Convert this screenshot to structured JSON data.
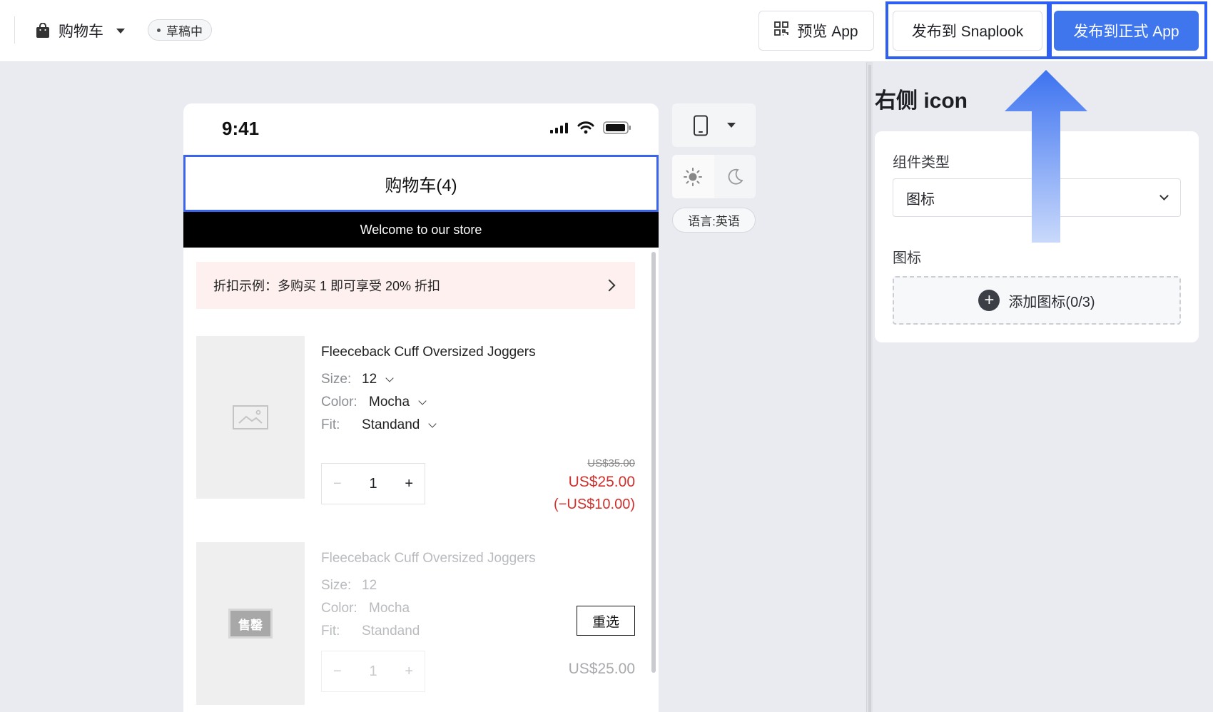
{
  "header": {
    "page_name": "购物车",
    "status": "草稿中",
    "preview_label": "预览 App",
    "publish_snaplook_label": "发布到 Snaplook",
    "publish_app_label": "发布到正式 App"
  },
  "phone": {
    "time": "9:41",
    "nav_title": "购物车(4)",
    "announcement": "Welcome to our store",
    "discount_text": "折扣示例：多购买 1 即可享受 20% 折扣",
    "items": [
      {
        "title": "Fleeceback Cuff Oversized Joggers",
        "size_label": "Size:",
        "size": "12",
        "color_label": "Color:",
        "color": "Mocha",
        "fit_label": "Fit:",
        "fit": "Standand",
        "qty": "1",
        "minus": "−",
        "plus": "+",
        "price_original": "US$35.00",
        "price": "US$25.00",
        "saving": "(−US$10.00)"
      },
      {
        "title": "Fleeceback Cuff Oversized Joggers",
        "size_label": "Size:",
        "size": "12",
        "color_label": "Color:",
        "color": "Mocha",
        "fit_label": "Fit:",
        "fit": "Standand",
        "qty": "1",
        "minus": "−",
        "plus": "+",
        "price": "US$25.00",
        "sold_out_badge": "售罄",
        "reselect_label": "重选"
      }
    ]
  },
  "tools": {
    "device_icon": "mobile-phone-icon",
    "light_icon": "sun-icon",
    "dark_icon": "moon-icon",
    "language_label": "语言:英语"
  },
  "panel": {
    "heading": "右侧 icon",
    "component_type_label": "组件类型",
    "component_type_value": "图标",
    "icon_label": "图标",
    "add_icon_label": "添加图标(0/3)"
  },
  "colors": {
    "accent": "#3f76ee",
    "highlight": "#2f5ff0",
    "price_red": "#d0312d",
    "discount_bg": "#fdf0ef"
  }
}
